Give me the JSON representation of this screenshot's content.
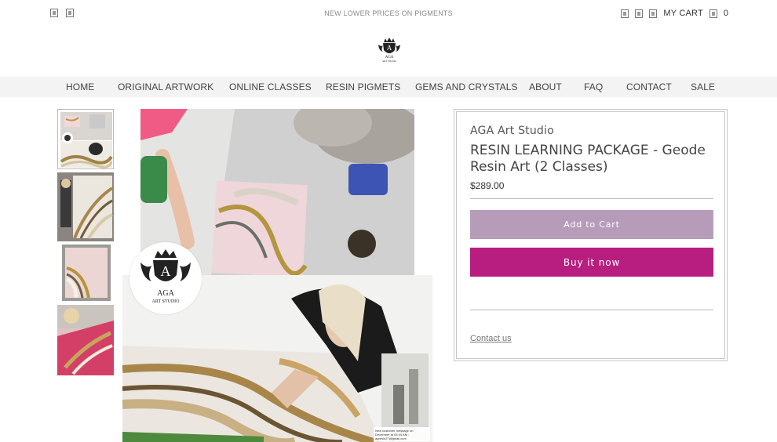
{
  "topbar": {
    "promo": "NEW LOWER PRICES ON PIGMENTS",
    "social_icons": [
      "social-icon",
      "social-icon"
    ],
    "util_icons": [
      "account-icon",
      "search-icon",
      "menu-icon"
    ],
    "cart_label": "MY CART",
    "cart_icon": "cart-icon",
    "cart_count": "0"
  },
  "nav": {
    "items": [
      {
        "label": "HOME"
      },
      {
        "label": "ORIGINAL ARTWORK"
      },
      {
        "label": "ONLINE CLASSES"
      },
      {
        "label": "RESIN PIGMETS"
      },
      {
        "label": "GEMS AND CRYSTALS"
      },
      {
        "label": "ABOUT"
      },
      {
        "label": "FAQ"
      },
      {
        "label": "CONTACT"
      },
      {
        "label": "SALE"
      }
    ]
  },
  "logo": {
    "letter": "A",
    "brand": "AGA",
    "sub": "ART STUDIO"
  },
  "product": {
    "vendor": "AGA Art Studio",
    "title": "RESIN LEARNING PACKAGE - Geode Resin Art (2 Classes)",
    "price": "$289.00",
    "add_to_cart": "Add to Cart",
    "buy_now": "Buy it now",
    "contact": "Contact us"
  },
  "image_caption": "New customer message on December at 03:44 AM - agresin27@gmail.com",
  "colors": {
    "accent": "#b71e80",
    "add_to_cart": "#b79cb9",
    "nav_bg": "#f3f3f3"
  }
}
